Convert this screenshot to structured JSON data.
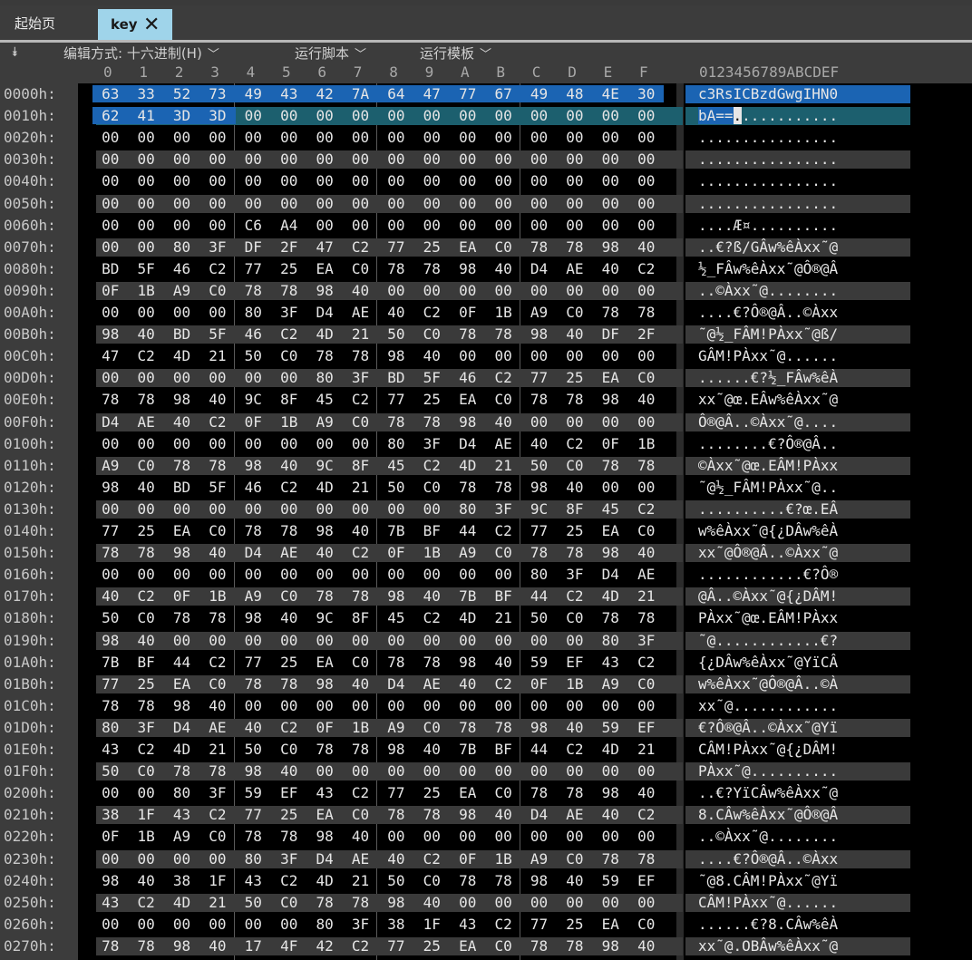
{
  "tabs": {
    "home": "起始页",
    "active": "key",
    "close_glyph": "✕"
  },
  "toolbar": {
    "edit_mode": "编辑方式: 十六进制(H)",
    "run_script": "运行脚本",
    "run_template": "运行模板"
  },
  "header": {
    "hex_columns": [
      "0",
      "1",
      "2",
      "3",
      "4",
      "5",
      "6",
      "7",
      "8",
      "9",
      "A",
      "B",
      "C",
      "D",
      "E",
      "F"
    ],
    "ascii_columns": "0123456789ABCDEF"
  },
  "rows": [
    {
      "offset": "0000h:",
      "bytes": [
        "63",
        "33",
        "52",
        "73",
        "49",
        "43",
        "42",
        "7A",
        "64",
        "47",
        "77",
        "67",
        "49",
        "48",
        "4E",
        "30"
      ],
      "ascii": "c3RsICBzdGwgIHN0"
    },
    {
      "offset": "0010h:",
      "bytes": [
        "62",
        "41",
        "3D",
        "3D",
        "00",
        "00",
        "00",
        "00",
        "00",
        "00",
        "00",
        "00",
        "00",
        "00",
        "00",
        "00"
      ],
      "ascii": "bA==............"
    },
    {
      "offset": "0020h:",
      "bytes": [
        "00",
        "00",
        "00",
        "00",
        "00",
        "00",
        "00",
        "00",
        "00",
        "00",
        "00",
        "00",
        "00",
        "00",
        "00",
        "00"
      ],
      "ascii": "................"
    },
    {
      "offset": "0030h:",
      "bytes": [
        "00",
        "00",
        "00",
        "00",
        "00",
        "00",
        "00",
        "00",
        "00",
        "00",
        "00",
        "00",
        "00",
        "00",
        "00",
        "00"
      ],
      "ascii": "................"
    },
    {
      "offset": "0040h:",
      "bytes": [
        "00",
        "00",
        "00",
        "00",
        "00",
        "00",
        "00",
        "00",
        "00",
        "00",
        "00",
        "00",
        "00",
        "00",
        "00",
        "00"
      ],
      "ascii": "................"
    },
    {
      "offset": "0050h:",
      "bytes": [
        "00",
        "00",
        "00",
        "00",
        "00",
        "00",
        "00",
        "00",
        "00",
        "00",
        "00",
        "00",
        "00",
        "00",
        "00",
        "00"
      ],
      "ascii": "................"
    },
    {
      "offset": "0060h:",
      "bytes": [
        "00",
        "00",
        "00",
        "00",
        "C6",
        "A4",
        "00",
        "00",
        "00",
        "00",
        "00",
        "00",
        "00",
        "00",
        "00",
        "00"
      ],
      "ascii": "....Æ¤.........."
    },
    {
      "offset": "0070h:",
      "bytes": [
        "00",
        "00",
        "80",
        "3F",
        "DF",
        "2F",
        "47",
        "C2",
        "77",
        "25",
        "EA",
        "C0",
        "78",
        "78",
        "98",
        "40"
      ],
      "ascii": "..€?ß/GÂw%êÀxx˜@"
    },
    {
      "offset": "0080h:",
      "bytes": [
        "BD",
        "5F",
        "46",
        "C2",
        "77",
        "25",
        "EA",
        "C0",
        "78",
        "78",
        "98",
        "40",
        "D4",
        "AE",
        "40",
        "C2"
      ],
      "ascii": "½_FÂw%êÀxx˜@Ô®@Â"
    },
    {
      "offset": "0090h:",
      "bytes": [
        "0F",
        "1B",
        "A9",
        "C0",
        "78",
        "78",
        "98",
        "40",
        "00",
        "00",
        "00",
        "00",
        "00",
        "00",
        "00",
        "00"
      ],
      "ascii": "..©Àxx˜@........"
    },
    {
      "offset": "00A0h:",
      "bytes": [
        "00",
        "00",
        "00",
        "00",
        "80",
        "3F",
        "D4",
        "AE",
        "40",
        "C2",
        "0F",
        "1B",
        "A9",
        "C0",
        "78",
        "78"
      ],
      "ascii": "....€?Ô®@Â..©Àxx"
    },
    {
      "offset": "00B0h:",
      "bytes": [
        "98",
        "40",
        "BD",
        "5F",
        "46",
        "C2",
        "4D",
        "21",
        "50",
        "C0",
        "78",
        "78",
        "98",
        "40",
        "DF",
        "2F"
      ],
      "ascii": "˜@½_FÂM!PÀxx˜@ß/"
    },
    {
      "offset": "00C0h:",
      "bytes": [
        "47",
        "C2",
        "4D",
        "21",
        "50",
        "C0",
        "78",
        "78",
        "98",
        "40",
        "00",
        "00",
        "00",
        "00",
        "00",
        "00"
      ],
      "ascii": "GÂM!PÀxx˜@......"
    },
    {
      "offset": "00D0h:",
      "bytes": [
        "00",
        "00",
        "00",
        "00",
        "00",
        "00",
        "80",
        "3F",
        "BD",
        "5F",
        "46",
        "C2",
        "77",
        "25",
        "EA",
        "C0"
      ],
      "ascii": "......€?½_FÂw%êÀ"
    },
    {
      "offset": "00E0h:",
      "bytes": [
        "78",
        "78",
        "98",
        "40",
        "9C",
        "8F",
        "45",
        "C2",
        "77",
        "25",
        "EA",
        "C0",
        "78",
        "78",
        "98",
        "40"
      ],
      "ascii": "xx˜@œ.EÂw%êÀxx˜@"
    },
    {
      "offset": "00F0h:",
      "bytes": [
        "D4",
        "AE",
        "40",
        "C2",
        "0F",
        "1B",
        "A9",
        "C0",
        "78",
        "78",
        "98",
        "40",
        "00",
        "00",
        "00",
        "00"
      ],
      "ascii": "Ô®@Â..©Àxx˜@...."
    },
    {
      "offset": "0100h:",
      "bytes": [
        "00",
        "00",
        "00",
        "00",
        "00",
        "00",
        "00",
        "00",
        "80",
        "3F",
        "D4",
        "AE",
        "40",
        "C2",
        "0F",
        "1B"
      ],
      "ascii": "........€?Ô®@Â.."
    },
    {
      "offset": "0110h:",
      "bytes": [
        "A9",
        "C0",
        "78",
        "78",
        "98",
        "40",
        "9C",
        "8F",
        "45",
        "C2",
        "4D",
        "21",
        "50",
        "C0",
        "78",
        "78"
      ],
      "ascii": "©Àxx˜@œ.EÂM!PÀxx"
    },
    {
      "offset": "0120h:",
      "bytes": [
        "98",
        "40",
        "BD",
        "5F",
        "46",
        "C2",
        "4D",
        "21",
        "50",
        "C0",
        "78",
        "78",
        "98",
        "40",
        "00",
        "00"
      ],
      "ascii": "˜@½_FÂM!PÀxx˜@.."
    },
    {
      "offset": "0130h:",
      "bytes": [
        "00",
        "00",
        "00",
        "00",
        "00",
        "00",
        "00",
        "00",
        "00",
        "00",
        "80",
        "3F",
        "9C",
        "8F",
        "45",
        "C2"
      ],
      "ascii": "..........€?œ.EÂ"
    },
    {
      "offset": "0140h:",
      "bytes": [
        "77",
        "25",
        "EA",
        "C0",
        "78",
        "78",
        "98",
        "40",
        "7B",
        "BF",
        "44",
        "C2",
        "77",
        "25",
        "EA",
        "C0"
      ],
      "ascii": "w%êÀxx˜@{¿DÂw%êÀ"
    },
    {
      "offset": "0150h:",
      "bytes": [
        "78",
        "78",
        "98",
        "40",
        "D4",
        "AE",
        "40",
        "C2",
        "0F",
        "1B",
        "A9",
        "C0",
        "78",
        "78",
        "98",
        "40"
      ],
      "ascii": "xx˜@Ô®@Â..©Àxx˜@"
    },
    {
      "offset": "0160h:",
      "bytes": [
        "00",
        "00",
        "00",
        "00",
        "00",
        "00",
        "00",
        "00",
        "00",
        "00",
        "00",
        "00",
        "80",
        "3F",
        "D4",
        "AE"
      ],
      "ascii": "............€?Ô®"
    },
    {
      "offset": "0170h:",
      "bytes": [
        "40",
        "C2",
        "0F",
        "1B",
        "A9",
        "C0",
        "78",
        "78",
        "98",
        "40",
        "7B",
        "BF",
        "44",
        "C2",
        "4D",
        "21"
      ],
      "ascii": "@Â..©Àxx˜@{¿DÂM!"
    },
    {
      "offset": "0180h:",
      "bytes": [
        "50",
        "C0",
        "78",
        "78",
        "98",
        "40",
        "9C",
        "8F",
        "45",
        "C2",
        "4D",
        "21",
        "50",
        "C0",
        "78",
        "78"
      ],
      "ascii": "PÀxx˜@œ.EÂM!PÀxx"
    },
    {
      "offset": "0190h:",
      "bytes": [
        "98",
        "40",
        "00",
        "00",
        "00",
        "00",
        "00",
        "00",
        "00",
        "00",
        "00",
        "00",
        "00",
        "00",
        "80",
        "3F"
      ],
      "ascii": "˜@............€?"
    },
    {
      "offset": "01A0h:",
      "bytes": [
        "7B",
        "BF",
        "44",
        "C2",
        "77",
        "25",
        "EA",
        "C0",
        "78",
        "78",
        "98",
        "40",
        "59",
        "EF",
        "43",
        "C2"
      ],
      "ascii": "{¿DÂw%êÀxx˜@YïCÂ"
    },
    {
      "offset": "01B0h:",
      "bytes": [
        "77",
        "25",
        "EA",
        "C0",
        "78",
        "78",
        "98",
        "40",
        "D4",
        "AE",
        "40",
        "C2",
        "0F",
        "1B",
        "A9",
        "C0"
      ],
      "ascii": "w%êÀxx˜@Ô®@Â..©À"
    },
    {
      "offset": "01C0h:",
      "bytes": [
        "78",
        "78",
        "98",
        "40",
        "00",
        "00",
        "00",
        "00",
        "00",
        "00",
        "00",
        "00",
        "00",
        "00",
        "00",
        "00"
      ],
      "ascii": "xx˜@............"
    },
    {
      "offset": "01D0h:",
      "bytes": [
        "80",
        "3F",
        "D4",
        "AE",
        "40",
        "C2",
        "0F",
        "1B",
        "A9",
        "C0",
        "78",
        "78",
        "98",
        "40",
        "59",
        "EF"
      ],
      "ascii": "€?Ô®@Â..©Àxx˜@Yï"
    },
    {
      "offset": "01E0h:",
      "bytes": [
        "43",
        "C2",
        "4D",
        "21",
        "50",
        "C0",
        "78",
        "78",
        "98",
        "40",
        "7B",
        "BF",
        "44",
        "C2",
        "4D",
        "21"
      ],
      "ascii": "CÂM!PÀxx˜@{¿DÂM!"
    },
    {
      "offset": "01F0h:",
      "bytes": [
        "50",
        "C0",
        "78",
        "78",
        "98",
        "40",
        "00",
        "00",
        "00",
        "00",
        "00",
        "00",
        "00",
        "00",
        "00",
        "00"
      ],
      "ascii": "PÀxx˜@.........."
    },
    {
      "offset": "0200h:",
      "bytes": [
        "00",
        "00",
        "80",
        "3F",
        "59",
        "EF",
        "43",
        "C2",
        "77",
        "25",
        "EA",
        "C0",
        "78",
        "78",
        "98",
        "40"
      ],
      "ascii": "..€?YïCÂw%êÀxx˜@"
    },
    {
      "offset": "0210h:",
      "bytes": [
        "38",
        "1F",
        "43",
        "C2",
        "77",
        "25",
        "EA",
        "C0",
        "78",
        "78",
        "98",
        "40",
        "D4",
        "AE",
        "40",
        "C2"
      ],
      "ascii": "8.CÂw%êÀxx˜@Ô®@Â"
    },
    {
      "offset": "0220h:",
      "bytes": [
        "0F",
        "1B",
        "A9",
        "C0",
        "78",
        "78",
        "98",
        "40",
        "00",
        "00",
        "00",
        "00",
        "00",
        "00",
        "00",
        "00"
      ],
      "ascii": "..©Àxx˜@........"
    },
    {
      "offset": "0230h:",
      "bytes": [
        "00",
        "00",
        "00",
        "00",
        "80",
        "3F",
        "D4",
        "AE",
        "40",
        "C2",
        "0F",
        "1B",
        "A9",
        "C0",
        "78",
        "78"
      ],
      "ascii": "....€?Ô®@Â..©Àxx"
    },
    {
      "offset": "0240h:",
      "bytes": [
        "98",
        "40",
        "38",
        "1F",
        "43",
        "C2",
        "4D",
        "21",
        "50",
        "C0",
        "78",
        "78",
        "98",
        "40",
        "59",
        "EF"
      ],
      "ascii": "˜@8.CÂM!PÀxx˜@Yï"
    },
    {
      "offset": "0250h:",
      "bytes": [
        "43",
        "C2",
        "4D",
        "21",
        "50",
        "C0",
        "78",
        "78",
        "98",
        "40",
        "00",
        "00",
        "00",
        "00",
        "00",
        "00"
      ],
      "ascii": "CÂM!PÀxx˜@......"
    },
    {
      "offset": "0260h:",
      "bytes": [
        "00",
        "00",
        "00",
        "00",
        "00",
        "00",
        "80",
        "3F",
        "38",
        "1F",
        "43",
        "C2",
        "77",
        "25",
        "EA",
        "C0"
      ],
      "ascii": "......€?8.CÂw%êÀ"
    },
    {
      "offset": "0270h:",
      "bytes": [
        "78",
        "78",
        "98",
        "40",
        "17",
        "4F",
        "42",
        "C2",
        "77",
        "25",
        "EA",
        "C0",
        "78",
        "78",
        "98",
        "40"
      ],
      "ascii": "xx˜@.OBÂw%êÀxx˜@"
    }
  ],
  "selection_colors": {
    "primary": "#1b64b3",
    "secondary": "#1c5f6e"
  }
}
